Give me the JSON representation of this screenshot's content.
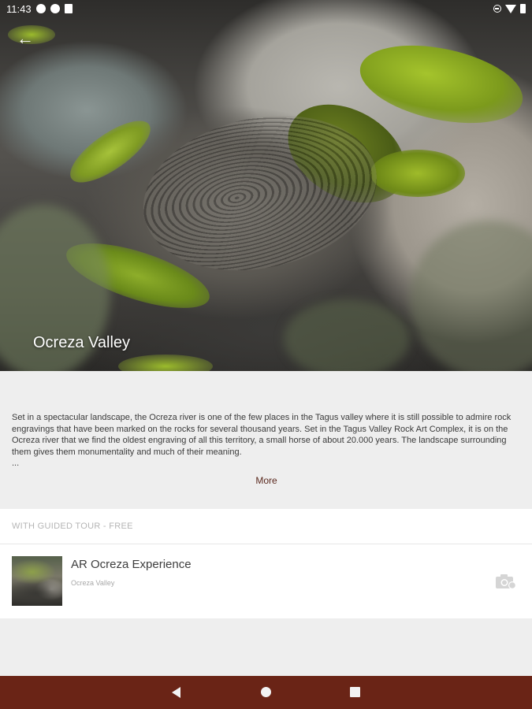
{
  "status_bar": {
    "time": "11:43",
    "left_icons": [
      "accessibility-icon",
      "notification-p-icon",
      "sd-card-icon"
    ],
    "right_icons": [
      "do-not-disturb-icon",
      "wifi-icon",
      "battery-icon"
    ]
  },
  "header": {
    "back_icon": "arrow-left-icon",
    "back_glyph": "←",
    "title": "Ocreza Valley"
  },
  "description": {
    "text": "Set in a spectacular landscape, the Ocreza river is one of the few places in the Tagus valley where it is still possible to admire rock engravings that have been marked on the rocks for several thousand years. Set in the Tagus Valley Rock Art Complex, it is on the Ocreza river that we find the oldest engraving of all this territory, a small horse of about 20.000 years. The landscape surrounding them gives them monumentality and much of their meaning.",
    "ellipsis": "...",
    "more_label": "More"
  },
  "section": {
    "header": "WITH GUIDED TOUR - FREE",
    "items": [
      {
        "title": "AR Ocreza Experience",
        "subtitle": "Ocreza Valley",
        "icon": "camera-ar-icon"
      }
    ]
  },
  "nav_bar": {
    "buttons": [
      "back-triangle-icon",
      "home-circle-icon",
      "recents-square-icon"
    ]
  },
  "colors": {
    "nav_bar": "#6a2416",
    "accent_text": "#5b2a1f",
    "background": "#eeeeee"
  }
}
